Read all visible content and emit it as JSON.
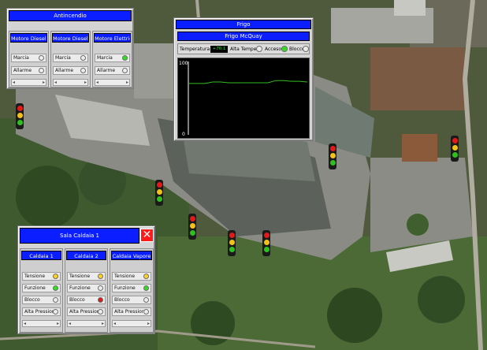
{
  "colors": {
    "title_blue": "#0a1eff",
    "led_on_green": "#33dd22",
    "led_on_yellow": "#ffd21e",
    "led_on_red": "#e01818",
    "led_off": "#ececec"
  },
  "antincendio": {
    "title": "Antincendio",
    "columns": [
      {
        "header": "Motore Diesel 1",
        "rows": [
          {
            "label": "Marcia",
            "state": "off"
          },
          {
            "label": "Allarme",
            "state": "off"
          }
        ]
      },
      {
        "header": "Motore Diesel 2",
        "rows": [
          {
            "label": "Marcia",
            "state": "off"
          },
          {
            "label": "Allarme",
            "state": "off"
          }
        ]
      },
      {
        "header": "Motore Elettrico",
        "rows": [
          {
            "label": "Marcia",
            "state": "green"
          },
          {
            "label": "Allarme",
            "state": "off"
          }
        ]
      }
    ]
  },
  "frigo": {
    "title": "Frigo",
    "subtitle": "Frigo McQuay",
    "temp_label": "Temperatura",
    "temp_value": "+70,1",
    "alta_temp_label": "Alta Temper.",
    "acceso_label": "Acceso",
    "blocco_label": "Blocco",
    "acceso_state": "green",
    "blocco_state": "off"
  },
  "chart_data": {
    "type": "line",
    "ylim": [
      0,
      100
    ],
    "ytick_labels": [
      "100",
      "0"
    ],
    "x": [
      0,
      20,
      30,
      40,
      50,
      60,
      70,
      80,
      90,
      100,
      110,
      120,
      130,
      140,
      150
    ],
    "values": [
      70,
      70,
      72,
      72,
      71,
      71,
      71,
      71,
      71,
      71,
      74,
      74,
      73,
      73,
      72
    ]
  },
  "caldaia": {
    "title": "Sala Caldaia 1",
    "columns": [
      {
        "header": "Caldaia 1",
        "rows": [
          {
            "label": "Tensione",
            "state": "yellow"
          },
          {
            "label": "Funzione",
            "state": "green"
          },
          {
            "label": "Blocco",
            "state": "off"
          },
          {
            "label": "Alta Pressione",
            "state": "off"
          }
        ]
      },
      {
        "header": "Caldaia 2",
        "rows": [
          {
            "label": "Tensione",
            "state": "yellow"
          },
          {
            "label": "Funzione",
            "state": "off"
          },
          {
            "label": "Blocco",
            "state": "red"
          },
          {
            "label": "Alta Pressione",
            "state": "off"
          }
        ]
      },
      {
        "header": "Caldaia Vapore",
        "rows": [
          {
            "label": "Tensione",
            "state": "yellow"
          },
          {
            "label": "Funzione",
            "state": "green"
          },
          {
            "label": "Blocco",
            "state": "off"
          },
          {
            "label": "Alta Pressione",
            "state": "off"
          }
        ]
      }
    ]
  },
  "traffic_lights": [
    {
      "name": "tl-1",
      "lamps": [
        "red",
        "yellow",
        "green"
      ]
    },
    {
      "name": "tl-2",
      "lamps": [
        "red",
        "yellow",
        "green"
      ]
    },
    {
      "name": "tl-3",
      "lamps": [
        "red",
        "yellow",
        "green"
      ]
    },
    {
      "name": "tl-4",
      "lamps": [
        "red",
        "yellow",
        "green"
      ]
    },
    {
      "name": "tl-5",
      "lamps": [
        "red",
        "yellow",
        "green"
      ]
    },
    {
      "name": "tl-6",
      "lamps": [
        "red",
        "yellow",
        "green"
      ]
    },
    {
      "name": "tl-7",
      "lamps": [
        "red",
        "yellow",
        "green"
      ]
    },
    {
      "name": "tl-8",
      "lamps": [
        "red",
        "yellow",
        "green"
      ]
    }
  ]
}
